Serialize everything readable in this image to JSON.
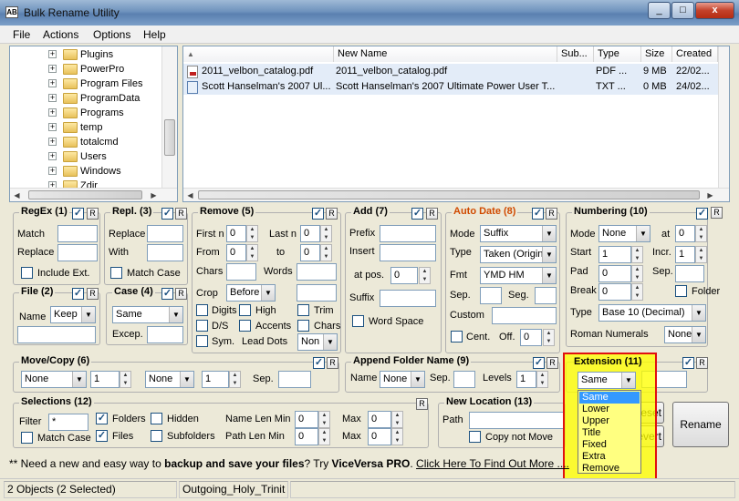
{
  "window": {
    "title": "Bulk Rename Utility",
    "icon_text": "AB",
    "minimize": "_",
    "maximize": "□",
    "close": "x"
  },
  "menu": [
    "File",
    "Actions",
    "Options",
    "Help"
  ],
  "tree": {
    "folders": [
      "Plugins",
      "PowerPro",
      "Program Files",
      "ProgramData",
      "Programs",
      "temp",
      "totalcmd",
      "Users",
      "Windows",
      "Zdir"
    ]
  },
  "file_list": {
    "columns": [
      "Name",
      "New Name",
      "Sub...",
      "Type",
      "Size",
      "Created"
    ],
    "rows": [
      {
        "name": "2011_velbon_catalog.pdf",
        "new_name": "2011_velbon_catalog.pdf",
        "sub": "",
        "type": "PDF ...",
        "size": "9 MB",
        "created": "22/02..."
      },
      {
        "name": "Scott Hanselman's 2007 Ul...",
        "new_name": "Scott Hanselman's 2007 Ultimate Power User T...",
        "sub": "",
        "type": "TXT ...",
        "size": "0 MB",
        "created": "24/02..."
      }
    ]
  },
  "regex": {
    "title": "RegEx (1)",
    "match": "Match",
    "replace": "Replace",
    "include_ext": "Include Ext."
  },
  "repl": {
    "title": "Repl. (3)",
    "replace": "Replace",
    "with": "With",
    "match_case": "Match Case"
  },
  "remove": {
    "title": "Remove (5)",
    "first_n": "First n",
    "first_n_val": "0",
    "last_n": "Last n",
    "last_n_val": "0",
    "from": "From",
    "from_val": "0",
    "to": "to",
    "to_val": "0",
    "chars": "Chars",
    "words": "Words",
    "crop": "Crop",
    "crop_val": "Before",
    "digits": "Digits",
    "high": "High",
    "trim": "Trim",
    "ds": "D/S",
    "accents": "Accents",
    "chars2": "Chars",
    "sym": "Sym.",
    "lead_dots": "Lead Dots",
    "lead_dots_val": "Non"
  },
  "add": {
    "title": "Add (7)",
    "prefix": "Prefix",
    "insert": "Insert",
    "at_pos": "at pos.",
    "at_pos_val": "0",
    "suffix": "Suffix",
    "word_space": "Word Space"
  },
  "auto_date": {
    "title": "Auto Date (8)",
    "mode": "Mode",
    "mode_val": "Suffix",
    "type": "Type",
    "type_val": "Taken (Origin",
    "fmt": "Fmt",
    "fmt_val": "YMD HM",
    "sep": "Sep.",
    "seg": "Seg.",
    "custom": "Custom",
    "cent": "Cent.",
    "off": "Off.",
    "off_val": "0"
  },
  "numbering": {
    "title": "Numbering (10)",
    "mode": "Mode",
    "mode_val": "None",
    "at": "at",
    "at_val": "0",
    "start": "Start",
    "start_val": "1",
    "incr": "Incr.",
    "incr_val": "1",
    "pad": "Pad",
    "pad_val": "0",
    "sep": "Sep.",
    "break": "Break",
    "break_val": "0",
    "folder": "Folder",
    "type": "Type",
    "type_val": "Base 10 (Decimal)",
    "roman": "Roman Numerals",
    "roman_val": "None"
  },
  "file": {
    "title": "File (2)",
    "name": "Name",
    "name_val": "Keep"
  },
  "case": {
    "title": "Case (4)",
    "val": "Same",
    "excep": "Excep."
  },
  "move_copy": {
    "title": "Move/Copy (6)",
    "combo1": "None",
    "num1": "1",
    "combo2": "None",
    "num2": "1",
    "sep": "Sep."
  },
  "append_folder": {
    "title": "Append Folder Name (9)",
    "name": "Name",
    "name_val": "None",
    "sep": "Sep.",
    "levels": "Levels",
    "levels_val": "1"
  },
  "extension": {
    "title": "Extension (11)",
    "val": "Same",
    "options": [
      "Same",
      "Lower",
      "Upper",
      "Title",
      "Fixed",
      "Extra",
      "Remove"
    ],
    "selected_index": 0
  },
  "selections": {
    "title": "Selections (12)",
    "filter": "Filter",
    "filter_val": "*",
    "folders": "Folders",
    "hidden": "Hidden",
    "name_len_min": "Name Len Min",
    "name_len_min_val": "0",
    "max": "Max",
    "max_val": "0",
    "match_case": "Match Case",
    "files": "Files",
    "subfolders": "Subfolders",
    "path_len_min": "Path Len Min",
    "path_len_min_val": "0",
    "max2": "Max",
    "max2_val": "0"
  },
  "new_location": {
    "title": "New Location (13)",
    "path": "Path",
    "copy_not_move": "Copy not Move"
  },
  "buttons": {
    "reset": "eset",
    "revert": "evert",
    "rename": "Rename"
  },
  "r_label": "R",
  "ad": {
    "pre": "** Need a new and easy way to ",
    "bold1": "backup and save your files",
    "mid": "? Try ",
    "bold2": "ViceVersa PRO",
    "dot": ". ",
    "link": "Click Here To Find Out More ...."
  },
  "status": {
    "objects": "2 Objects (2 Selected)",
    "file": "Outgoing_Holy_Trinit"
  },
  "colors": {
    "highlight_border": "#e01010",
    "highlight_fill": "#ffff00",
    "selected": "#3399ff",
    "orange_title": "#d04a00"
  }
}
